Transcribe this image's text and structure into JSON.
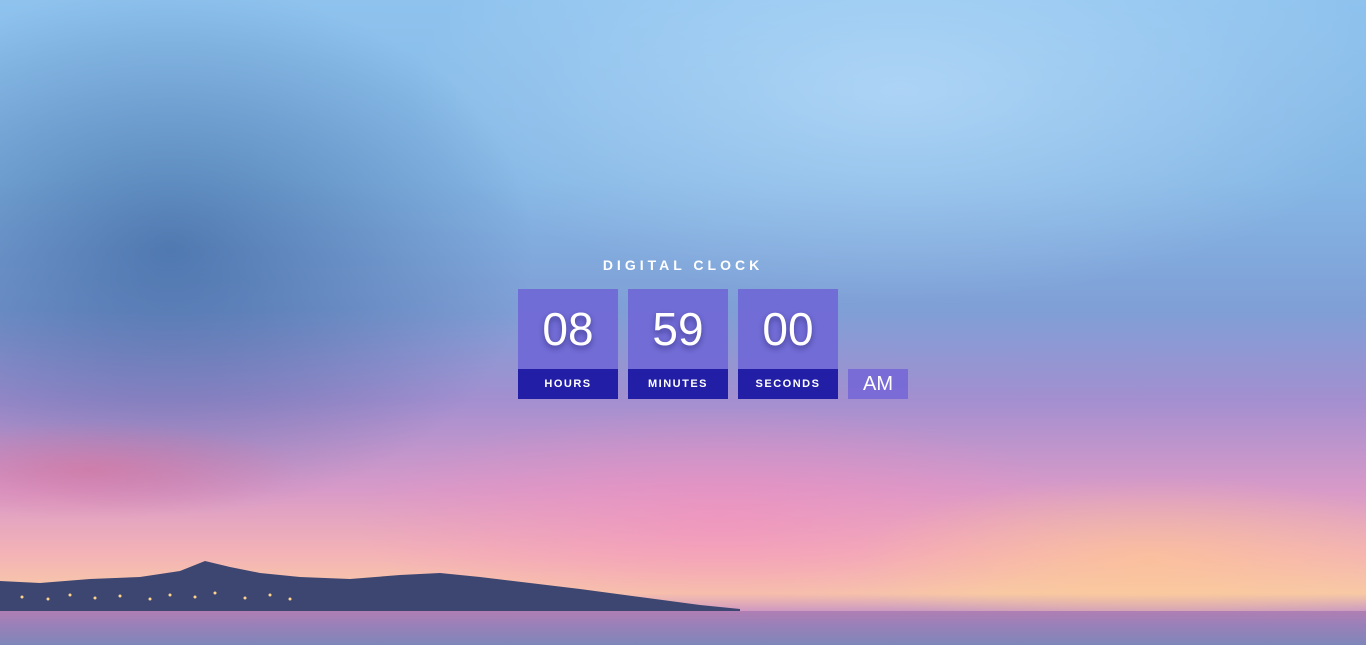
{
  "clock": {
    "title": "DIGITAL CLOCK",
    "hours": {
      "value": "08",
      "label": "HOURS"
    },
    "minutes": {
      "value": "59",
      "label": "MINUTES"
    },
    "seconds": {
      "value": "00",
      "label": "SECONDS"
    },
    "period": "AM"
  },
  "colors": {
    "tile_value": "#7068d6",
    "tile_label": "#221fa6",
    "text": "#ffffff"
  },
  "background": {
    "scene": "sunset-sky-over-sea"
  }
}
